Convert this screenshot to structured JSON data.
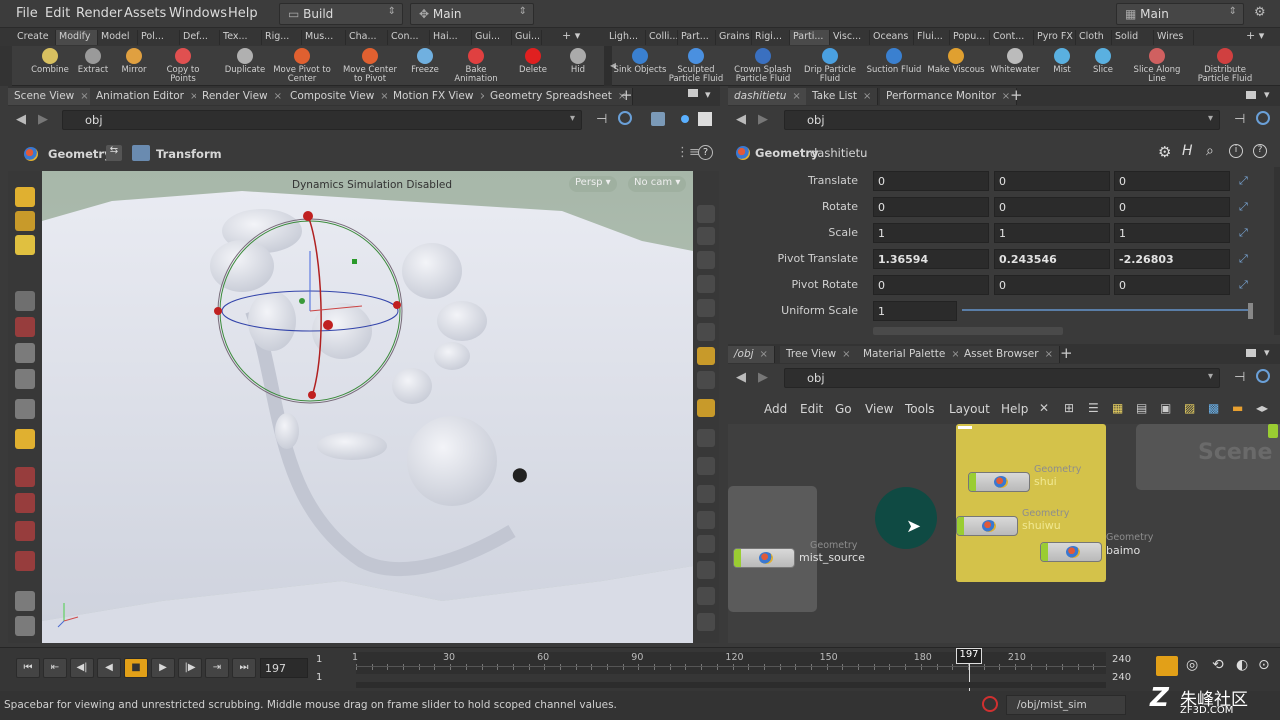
{
  "menubar": {
    "items": [
      "File",
      "Edit",
      "Render",
      "Assets",
      "Windows",
      "Help"
    ],
    "desktop": "Build",
    "context": "Main",
    "user_desktop": "Main"
  },
  "shelf_tabs_left": [
    "Create",
    "Modify",
    "Model",
    "Pol...",
    "Def...",
    "Tex...",
    "Rig...",
    "Mus...",
    "Cha...",
    "Con...",
    "Hai...",
    "Gui...",
    "Gui..."
  ],
  "shelf_tabs_right": [
    "Ligh...",
    "Colli...",
    "Part...",
    "Grains",
    "Rigi...",
    "Parti...",
    "Visc...",
    "Oceans",
    "Flui...",
    "Popu...",
    "Cont...",
    "Pyro FX",
    "Cloth",
    "Solid",
    "Wires"
  ],
  "shelf_tools_left": [
    "Combine",
    "Extract",
    "Mirror",
    "Copy to Points",
    "Duplicate",
    "Move Pivot to Center",
    "Move Center to Pivot",
    "Freeze",
    "Bake Animation",
    "Delete",
    "Hid"
  ],
  "shelf_tools_right": [
    "Sink Objects",
    "Sculpted Particle Fluid",
    "Crown Splash Particle Fluid",
    "Drip Particle Fluid",
    "Suction Fluid",
    "Make Viscous",
    "Whitewater",
    "Mist",
    "Slice",
    "Slice Along Line",
    "Distribute Particle Fluid"
  ],
  "left_pane": {
    "tabs": [
      "Scene View",
      "Animation Editor",
      "Render View",
      "Composite View",
      "Motion FX View",
      "Geometry Spreadsheet"
    ],
    "path": "obj",
    "context_label": "Geometry",
    "transform_label": "Transform",
    "viewport_message": "Dynamics Simulation Disabled",
    "persp": "Persp",
    "cam": "No cam"
  },
  "param_pane": {
    "tabs": [
      "dashitietu",
      "Take List",
      "Performance Monitor"
    ],
    "path": "obj",
    "node_type": "Geometry",
    "node_name": "dashitietu",
    "rows": [
      {
        "label": "Translate",
        "values": [
          "0",
          "0",
          "0"
        ]
      },
      {
        "label": "Rotate",
        "values": [
          "0",
          "0",
          "0"
        ]
      },
      {
        "label": "Scale",
        "values": [
          "1",
          "1",
          "1"
        ]
      },
      {
        "label": "Pivot Translate",
        "values": [
          "1.36594",
          "0.243546",
          "-2.26803"
        ]
      },
      {
        "label": "Pivot Rotate",
        "values": [
          "0",
          "0",
          "0"
        ]
      }
    ],
    "uniform_scale_label": "Uniform Scale",
    "uniform_scale_value": "1"
  },
  "network_pane": {
    "tabs": [
      "/obj",
      "Tree View",
      "Material Palette",
      "Asset Browser"
    ],
    "path": "obj",
    "menu": [
      "Add",
      "Edit",
      "Go",
      "View",
      "Tools",
      "Layout",
      "Help"
    ],
    "scene_watermark": "Scene",
    "nodes": [
      {
        "type": "Geometry",
        "name": "mist_source"
      },
      {
        "type": "Geometry",
        "name": "shui"
      },
      {
        "type": "Geometry",
        "name": "shuiwu"
      },
      {
        "type": "Geometry",
        "name": "baimo"
      }
    ]
  },
  "timeline": {
    "current_frame": "197",
    "start_top": "1",
    "start_bottom": "1",
    "end_top": "240",
    "end_bottom": "240",
    "ticks": [
      "1",
      "30",
      "60",
      "90",
      "120",
      "150",
      "180",
      "197",
      "210",
      "240"
    ]
  },
  "status": {
    "message": "Spacebar for viewing and unrestricted scrubbing. Middle mouse drag on frame slider to hold scoped channel values.",
    "path": "/obj/mist_sim",
    "watermark": "朱峰社区",
    "watermark_url": "ZF3D.COM"
  },
  "colors": {
    "accent_yellow": "#d4c24a",
    "network_bg": "#3f3f3f",
    "viewport_bg": "#b3c1b3"
  }
}
